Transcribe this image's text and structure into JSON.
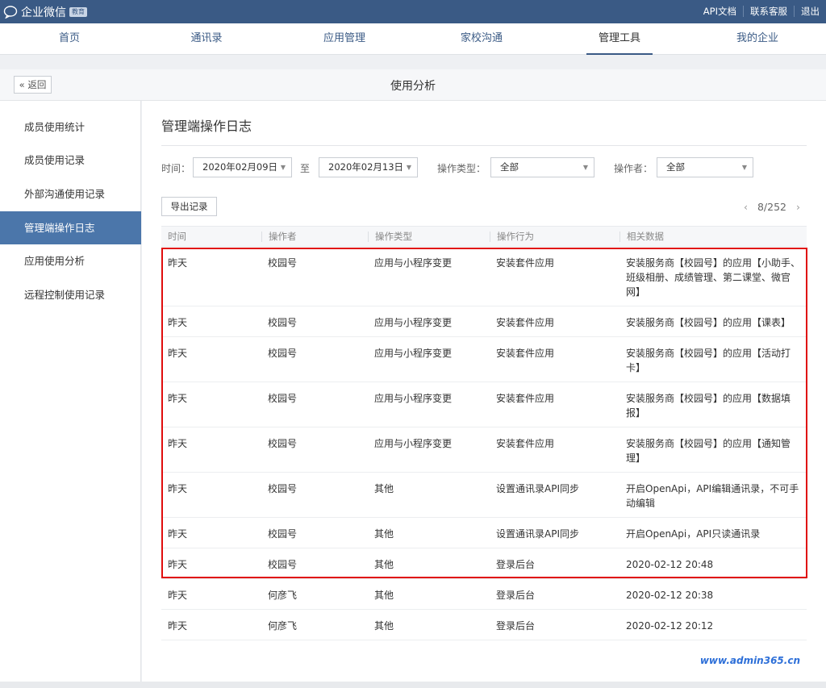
{
  "app": {
    "name": "企业微信",
    "badge": "教育"
  },
  "top_links": [
    "API文档",
    "联系客服",
    "退出"
  ],
  "nav": [
    {
      "label": "首页",
      "active": false
    },
    {
      "label": "通讯录",
      "active": false
    },
    {
      "label": "应用管理",
      "active": false
    },
    {
      "label": "家校沟通",
      "active": false
    },
    {
      "label": "管理工具",
      "active": true
    },
    {
      "label": "我的企业",
      "active": false
    }
  ],
  "pagebar": {
    "back_label": "返回",
    "title": "使用分析"
  },
  "sidebar": [
    {
      "label": "成员使用统计",
      "active": false
    },
    {
      "label": "成员使用记录",
      "active": false
    },
    {
      "label": "外部沟通使用记录",
      "active": false
    },
    {
      "label": "管理端操作日志",
      "active": true
    },
    {
      "label": "应用使用分析",
      "active": false
    },
    {
      "label": "远程控制使用记录",
      "active": false
    }
  ],
  "main": {
    "title": "管理端操作日志",
    "filters": {
      "time_label": "时间：",
      "start_date": "2020年02月09日",
      "to_label": "至",
      "end_date": "2020年02月13日",
      "type_label": "操作类型：",
      "type_value": "全部",
      "operator_label": "操作者：",
      "operator_value": "全部"
    },
    "export_label": "导出记录",
    "pager": {
      "page": "8/252"
    },
    "columns": [
      "时间",
      "操作者",
      "操作类型",
      "操作行为",
      "相关数据"
    ],
    "rows": [
      {
        "time": "昨天",
        "operator": "校园号",
        "type": "应用与小程序变更",
        "action": "安装套件应用",
        "data": "安装服务商【校园号】的应用【小助手、班级相册、成绩管理、第二课堂、微官网】"
      },
      {
        "time": "昨天",
        "operator": "校园号",
        "type": "应用与小程序变更",
        "action": "安装套件应用",
        "data": "安装服务商【校园号】的应用【课表】"
      },
      {
        "time": "昨天",
        "operator": "校园号",
        "type": "应用与小程序变更",
        "action": "安装套件应用",
        "data": "安装服务商【校园号】的应用【活动打卡】"
      },
      {
        "time": "昨天",
        "operator": "校园号",
        "type": "应用与小程序变更",
        "action": "安装套件应用",
        "data": "安装服务商【校园号】的应用【数据填报】"
      },
      {
        "time": "昨天",
        "operator": "校园号",
        "type": "应用与小程序变更",
        "action": "安装套件应用",
        "data": "安装服务商【校园号】的应用【通知管理】"
      },
      {
        "time": "昨天",
        "operator": "校园号",
        "type": "其他",
        "action": "设置通讯录API同步",
        "data": "开启OpenApi，API编辑通讯录，不可手动编辑"
      },
      {
        "time": "昨天",
        "operator": "校园号",
        "type": "其他",
        "action": "设置通讯录API同步",
        "data": "开启OpenApi，API只读通讯录"
      },
      {
        "time": "昨天",
        "operator": "校园号",
        "type": "其他",
        "action": "登录后台",
        "data": "2020-02-12 20:48"
      },
      {
        "time": "昨天",
        "operator": "何彦飞",
        "type": "其他",
        "action": "登录后台",
        "data": "2020-02-12 20:38"
      },
      {
        "time": "昨天",
        "operator": "何彦飞",
        "type": "其他",
        "action": "登录后台",
        "data": "2020-02-12 20:12"
      }
    ]
  },
  "watermark": "www.admin365.cn",
  "colors": {
    "brand": "#3a5a85",
    "active_side": "#4b76aa",
    "highlight": "#e00d0d"
  }
}
